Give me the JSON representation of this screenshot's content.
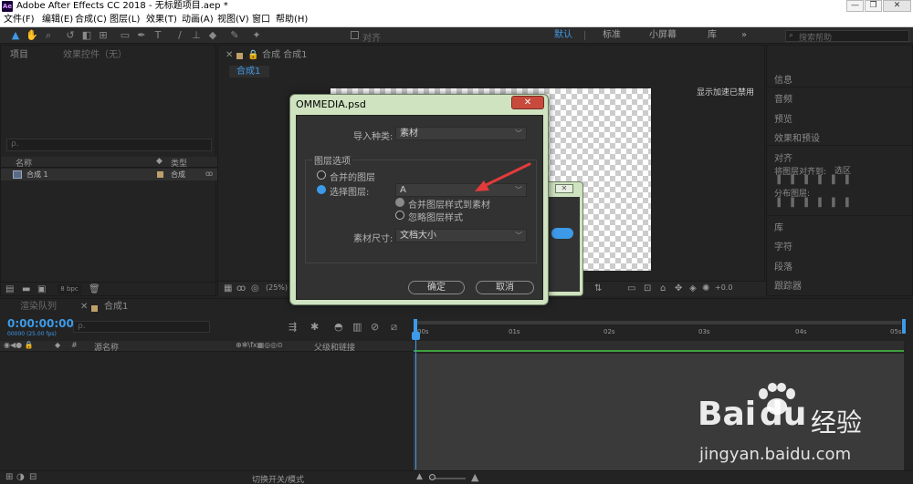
{
  "window": {
    "title": "Adobe After Effects CC 2018 - 无标题项目.aep *",
    "logo": "Ae",
    "minimize": "—",
    "maximize": "❐",
    "close": "✕"
  },
  "menu": [
    "文件(F)",
    "编辑(E)",
    "合成(C)",
    "图层(L)",
    "效果(T)",
    "动画(A)",
    "视图(V)",
    "窗口",
    "帮助(H)"
  ],
  "toolbar": {
    "align_label": "对齐",
    "workspaces": [
      "默认",
      "标准",
      "小屏幕",
      "库"
    ],
    "active_workspace": "默认",
    "more": "»",
    "search_placeholder": "搜索帮助"
  },
  "project_panel": {
    "tab_project": "项目",
    "tab_effects": "效果控件（无）",
    "search_placeholder": "ρ.",
    "col_name": "名称",
    "col_type": "类型",
    "row_name": "合成 1",
    "row_type": "合成",
    "bpc": "8 bpc"
  },
  "comp_panel": {
    "tab": "合成 合成1",
    "subtab": "合成1",
    "accel_note": "显示加速已禁用",
    "zoom": "(25%)",
    "offset": "+0.0"
  },
  "right_panel": {
    "items": [
      "信息",
      "音频",
      "预览",
      "效果和预设",
      "对齐",
      "字符",
      "段落",
      "跟踪器"
    ],
    "align_to_label": "将图层对齐到:",
    "align_to_value": "选区",
    "distribute_label": "分布图层:",
    "library": "库"
  },
  "timeline": {
    "tab_render": "渲染队列",
    "tab_comp": "合成1",
    "timecode": "0:00:00:00",
    "timecode_sub": "00000 (25.00 fps)",
    "search_placeholder": "ρ.",
    "col_source": "源名称",
    "col_parent": "父级和链接",
    "ruler_ticks": [
      "00s",
      "01s",
      "02s",
      "03s",
      "04s",
      "05s"
    ],
    "toggle_label": "切换开关/模式"
  },
  "dialog": {
    "title": "OMMEDIA.psd",
    "close": "✕",
    "import_type_label": "导入种类:",
    "import_type_value": "素材",
    "layer_options_label": "图层选项",
    "radio_merged": "合并的图层",
    "radio_choose": "选择图层:",
    "layer_value": "A",
    "opt_merge_style": "合并图层样式到素材",
    "opt_ignore_style": "忽略图层样式",
    "footage_size_label": "素材尺寸:",
    "footage_size_value": "文档大小",
    "ok": "确定",
    "cancel": "取消"
  },
  "watermark": {
    "brand": "Bai",
    "brand2": "du",
    "cn": "经验",
    "url": "jingyan.baidu.com"
  },
  "colors": {
    "accent": "#3d9ae8",
    "dialog_frame": "#cfe3c0",
    "close_red": "#c84a3c",
    "arrow": "#e23b3b",
    "timeline_green": "#3fa03f"
  }
}
